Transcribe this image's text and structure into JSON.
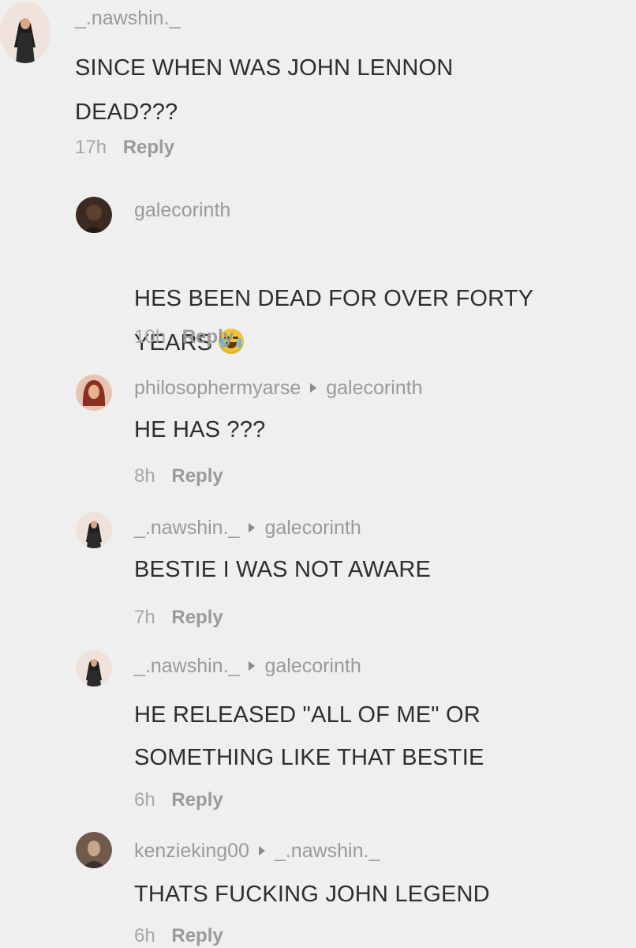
{
  "comments": [
    {
      "username": "_.nawshin._",
      "reply_to": "",
      "text": "SINCE WHEN WAS JOHN LENNON\nDEAD???",
      "time": "17h",
      "reply_label": "Reply"
    },
    {
      "username": "galecorinth",
      "reply_to": "",
      "text": "HES BEEN DEAD FOR OVER FORTY\nYEARS",
      "emoji": "loudly-crying-face-emoji",
      "time": "10h",
      "reply_label": "Reply"
    },
    {
      "username": "philosophermyarse",
      "reply_to": "galecorinth",
      "text": "HE HAS ???",
      "time": "8h",
      "reply_label": "Reply"
    },
    {
      "username": "_.nawshin._",
      "reply_to": "galecorinth",
      "text": "BESTIE I WAS NOT AWARE",
      "time": "7h",
      "reply_label": "Reply"
    },
    {
      "username": "_.nawshin._",
      "reply_to": "galecorinth",
      "text": "HE RELEASED \"ALL OF ME\" OR\nSOMETHING LIKE THAT BESTIE",
      "time": "6h",
      "reply_label": "Reply"
    },
    {
      "username": "kenzieking00",
      "reply_to": "_.nawshin._",
      "text": "THATS FUCKING JOHN LEGEND",
      "time": "6h",
      "reply_label": "Reply"
    }
  ],
  "icons": {
    "reply_arrow": "caret-right-icon",
    "avatar_top": "profile-avatar-icon"
  },
  "colors": {
    "background": "#efefef",
    "username": "#9a9a9a",
    "body_text": "#2e2e2e",
    "meta_text": "#a7a7a7"
  }
}
